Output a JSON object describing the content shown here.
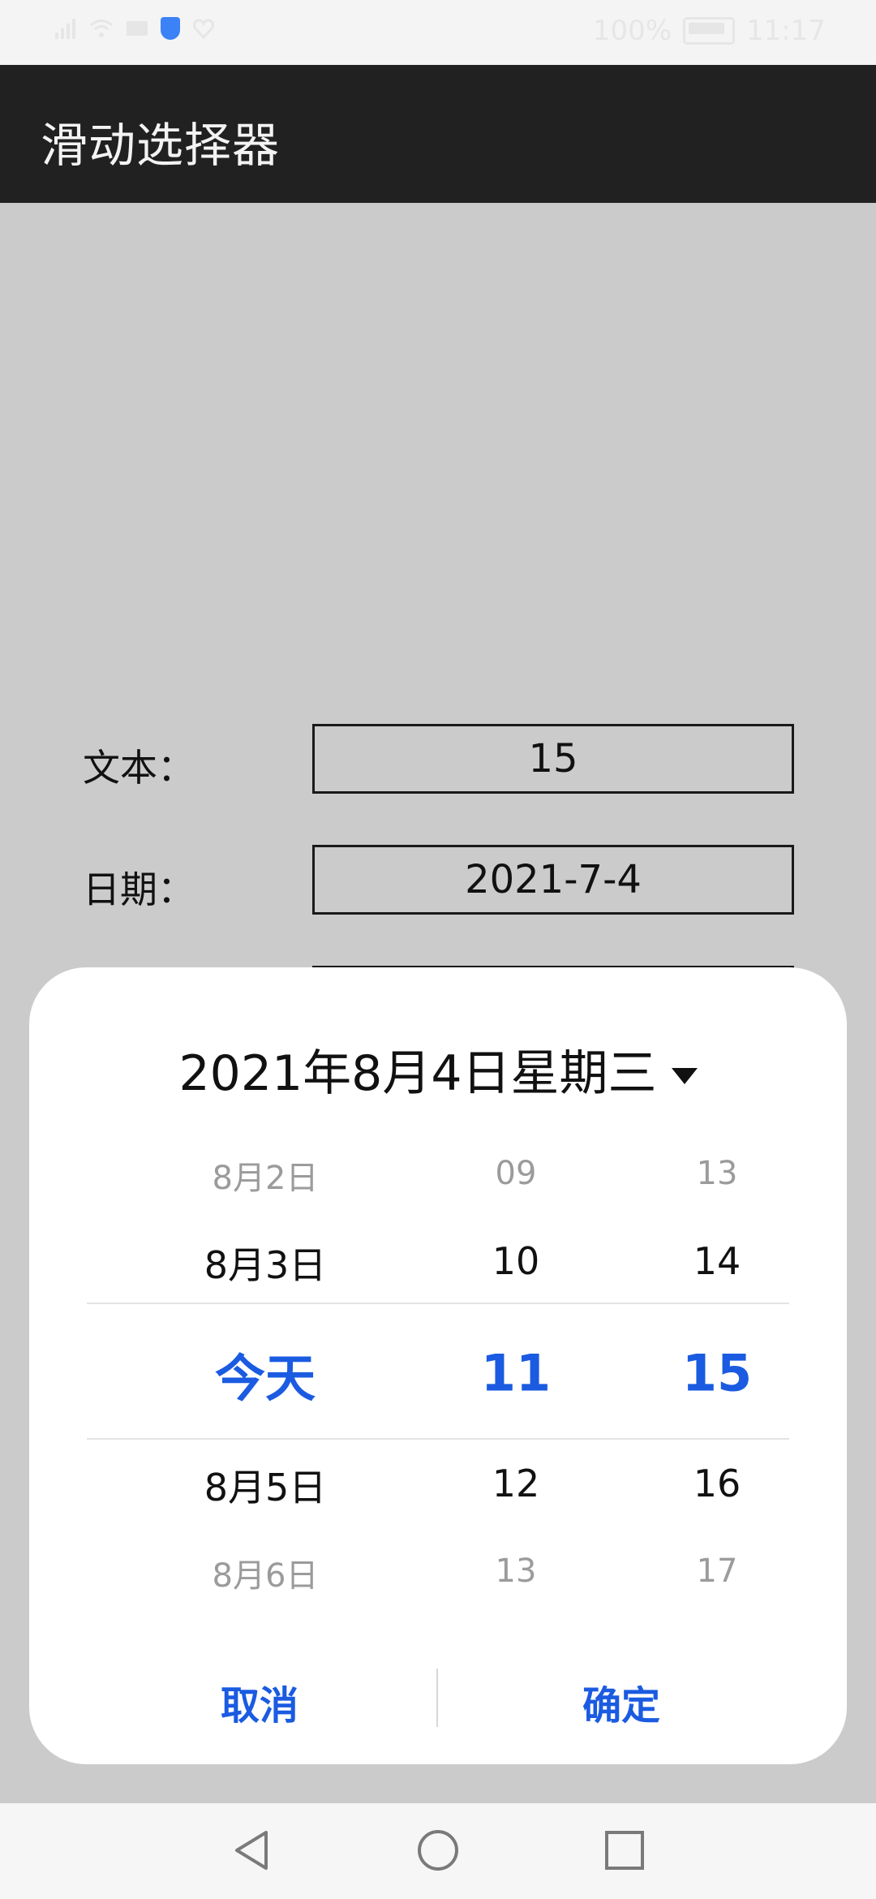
{
  "status_bar": {
    "battery_text": "100%",
    "time": "11:17"
  },
  "app_bar": {
    "title": "滑动选择器"
  },
  "form": {
    "text_label": "文本：",
    "text_value": "15",
    "date_label": "日期：",
    "date_value": "2021-7-4"
  },
  "picker": {
    "headline": "2021年8月4日星期三",
    "day_col": [
      "8月2日",
      "8月3日",
      "今天",
      "8月5日",
      "8月6日"
    ],
    "hour_col": [
      "09",
      "10",
      "11",
      "12",
      "13"
    ],
    "minute_col": [
      "13",
      "14",
      "15",
      "16",
      "17"
    ],
    "cancel_label": "取消",
    "confirm_label": "确定"
  },
  "colors": {
    "accent": "#1a5be1",
    "app_bar_bg": "#212121",
    "overlay_bg": "#cbcbcb"
  },
  "nav": {
    "back": "back-icon",
    "home": "home-icon",
    "recents": "recents-icon"
  }
}
